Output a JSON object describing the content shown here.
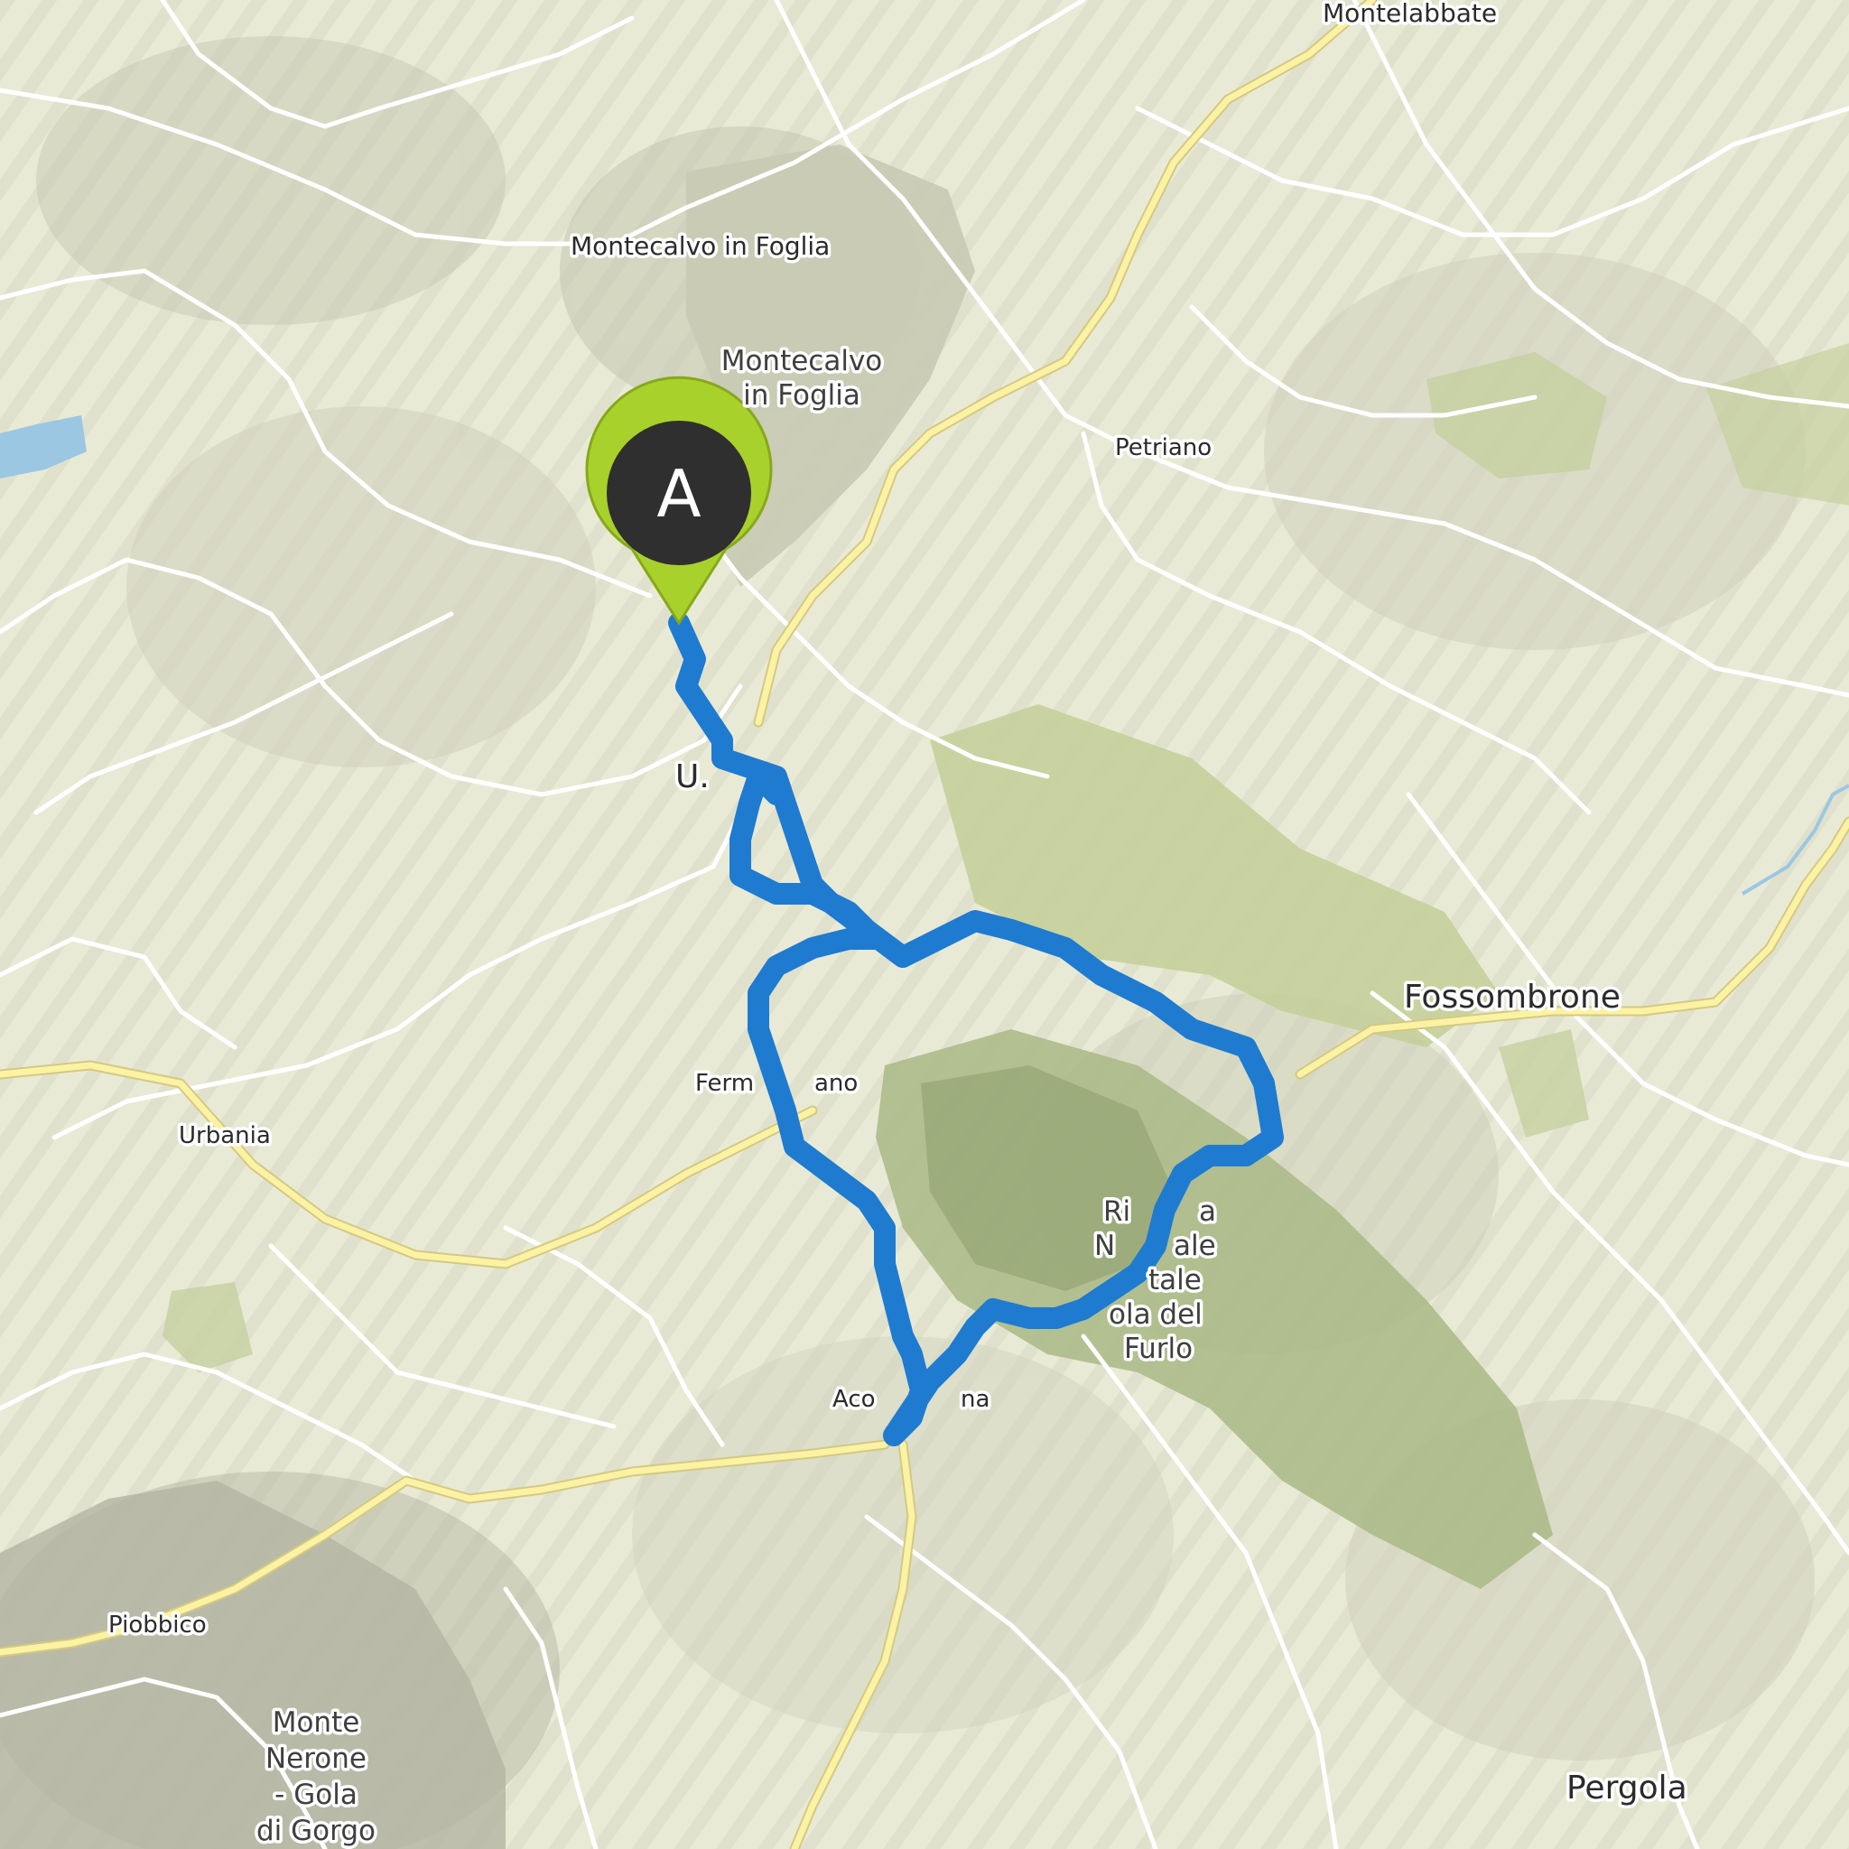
{
  "map": {
    "marker": {
      "letter": "A",
      "pin_color": "#a9d12b",
      "inner_color": "#2f2f2f"
    },
    "route_color": "#1e7bd0",
    "places": {
      "montelabbate": "Montelabbate",
      "montecalvo_town": "Montecalvo in Foglia",
      "montecalvo_area_1": "Montecalvo",
      "montecalvo_area_2": "in Foglia",
      "petriano": "Petriano",
      "urbino_partial": "U.",
      "fossombrone": "Fossombrone",
      "fermignano_partial": "Ferm",
      "fermignano_partial_end": "ano",
      "urbania": "Urbania",
      "reserve_1": "Ri",
      "reserve_1b": "a",
      "reserve_2": "N",
      "reserve_2b": "ale",
      "reserve_3": "tale",
      "reserve_4": "ola del",
      "reserve_5": "Furlo",
      "acqualagna_partial": "Aco",
      "acqualagna_partial_end": "na",
      "piobbico": "Piobbico",
      "monte_nerone_1": "Monte",
      "monte_nerone_2": "Nerone",
      "monte_nerone_3": "- Gola",
      "monte_nerone_4": "di Gorgo",
      "pergola": "Pergola"
    }
  }
}
